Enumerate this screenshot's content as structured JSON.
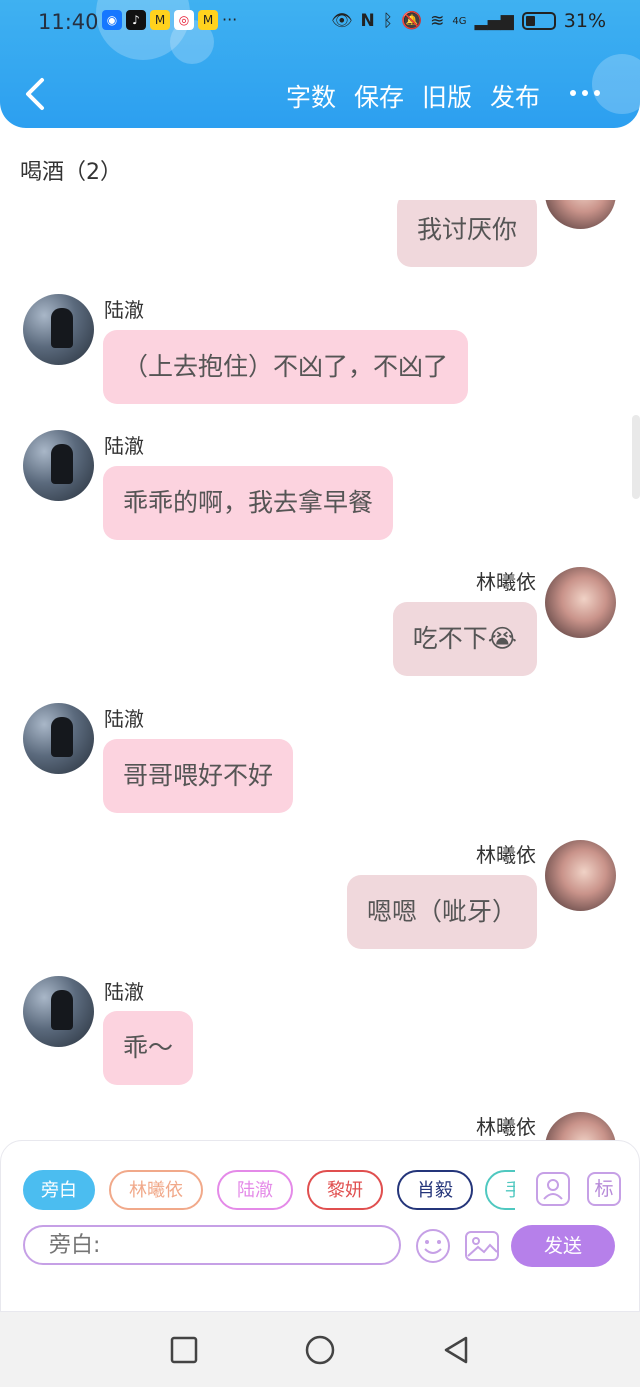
{
  "status_bar": {
    "time": "11:40",
    "notif_icons": [
      "alipay-icon",
      "tiktok-icon",
      "meituan-icon",
      "weibo-icon",
      "meituan-icon"
    ],
    "more_notifs": "···",
    "network": "4G",
    "battery": "31%"
  },
  "header": {
    "actions": [
      "字数",
      "保存",
      "旧版",
      "发布"
    ]
  },
  "chapter": {
    "title": "喝酒（2）"
  },
  "messages": [
    {
      "side": "right",
      "sender": "",
      "text": "我讨厌你"
    },
    {
      "side": "left",
      "sender": "陆澈",
      "text": "（上去抱住）不凶了，不凶了"
    },
    {
      "side": "left",
      "sender": "陆澈",
      "text": "乖乖的啊，我去拿早餐"
    },
    {
      "side": "right",
      "sender": "林曦依",
      "text": "吃不下😭"
    },
    {
      "side": "left",
      "sender": "陆澈",
      "text": "哥哥喂好不好"
    },
    {
      "side": "right",
      "sender": "林曦依",
      "text": "嗯嗯（呲牙）"
    },
    {
      "side": "left",
      "sender": "陆澈",
      "text": "乖～"
    },
    {
      "side": "right",
      "sender": "林曦依",
      "text": ""
    }
  ],
  "input_bar": {
    "roles": [
      {
        "label": "旁白",
        "active": true,
        "color": "#4bbdf0"
      },
      {
        "label": "林曦依",
        "active": false,
        "color": "#f1a98a"
      },
      {
        "label": "陆澈",
        "active": false,
        "color": "#e48ae8"
      },
      {
        "label": "黎妍",
        "active": false,
        "color": "#e04f4f"
      },
      {
        "label": "肖毅",
        "active": false,
        "color": "#24357a"
      },
      {
        "label": "手",
        "active": false,
        "color": "#4fc8c0"
      }
    ],
    "tag_label": "标",
    "placeholder": "旁白:",
    "send_label": "发送"
  },
  "colors": {
    "header": "#3aabf1",
    "accent_purple": "#b680ea",
    "bubble_left": "#fcd3df",
    "bubble_right": "#f0d8dc"
  }
}
